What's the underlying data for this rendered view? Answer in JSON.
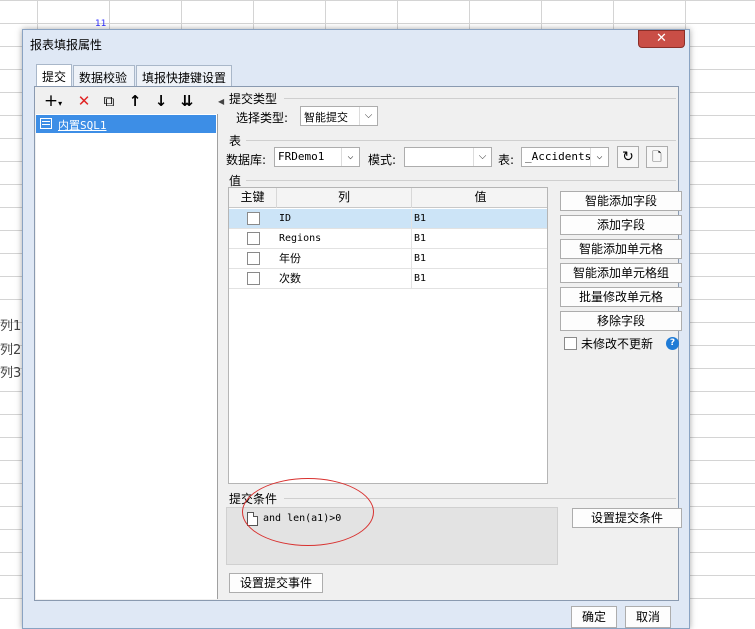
{
  "background": {
    "column_number": "11",
    "row_labels": [
      "列1",
      "列2",
      "列3"
    ]
  },
  "dialog": {
    "title": "报表填报属性",
    "close_symbol": "✕",
    "tabs": [
      "提交",
      "数据校验",
      "填报快捷键设置"
    ],
    "active_tab": "提交"
  },
  "left_panel": {
    "toolbar_icons": [
      "add-icon",
      "delete-icon",
      "copy-icon",
      "move-up-icon",
      "move-down-icon",
      "sort-icon"
    ],
    "tree_items": [
      {
        "label": "内置SQL1",
        "selected": true
      }
    ]
  },
  "submit_type": {
    "section_label": "提交类型",
    "select_label": "选择类型:",
    "selected_value": "智能提交"
  },
  "table_section": {
    "section_label": "表",
    "database_label": "数据库:",
    "database_value": "FRDemo1",
    "schema_label": "模式:",
    "schema_value": "",
    "table_label": "表:",
    "table_value": "_Accidents"
  },
  "value_section": {
    "section_label": "值",
    "columns": [
      "主键",
      "列",
      "值"
    ],
    "rows": [
      {
        "key": false,
        "column": "ID",
        "value": "B1",
        "selected": true
      },
      {
        "key": false,
        "column": "Regions",
        "value": "B1",
        "selected": false
      },
      {
        "key": false,
        "column": "年份",
        "value": "B1",
        "selected": false
      },
      {
        "key": false,
        "column": "次数",
        "value": "B1",
        "selected": false
      }
    ],
    "buttons": [
      "智能添加字段",
      "添加字段",
      "智能添加单元格",
      "智能添加单元格组",
      "批量修改单元格",
      "移除字段"
    ],
    "unmodified_no_update_label": "未修改不更新",
    "help_symbol": "?"
  },
  "submit_condition": {
    "section_label": "提交条件",
    "condition_text": "and len(a1)>0",
    "set_condition_button": "设置提交条件"
  },
  "submit_event_button": "设置提交事件",
  "footer": {
    "ok": "确定",
    "cancel": "取消"
  },
  "colors": {
    "selection": "#3d8ee6",
    "row_selected": "#cce4f7",
    "close": "#c94e46",
    "annotation": "#d8312f",
    "help": "#1f7bd6"
  }
}
